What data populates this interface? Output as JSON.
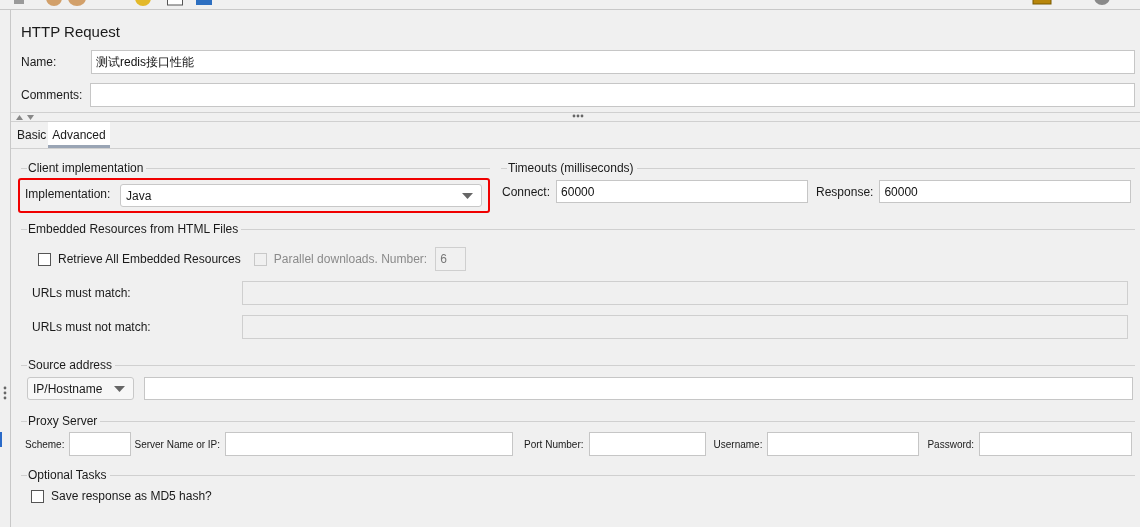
{
  "title": "HTTP Request",
  "name": {
    "label": "Name:",
    "value": "测试redis接口性能"
  },
  "comments": {
    "label": "Comments:"
  },
  "tabs": [
    {
      "label": "Basic",
      "selected": false
    },
    {
      "label": "Advanced",
      "selected": true
    }
  ],
  "client_implementation": {
    "title": "Client implementation",
    "label": "Implementation:",
    "value": "Java",
    "highlighted": true
  },
  "timeouts": {
    "title": "Timeouts (milliseconds)",
    "fields": [
      {
        "label": "Connect:",
        "value": "60000"
      },
      {
        "label": "Response:",
        "value": "60000"
      }
    ]
  },
  "embedded_resources": {
    "title": "Embedded Resources from HTML Files",
    "retrieve_all": {
      "label": "Retrieve All Embedded Resources",
      "checked": false
    },
    "parallel": {
      "label": "Parallel downloads. Number:",
      "checked": false,
      "disabled": true,
      "value": "6"
    },
    "url_filters": [
      {
        "label": "URLs must match:",
        "disabled": true
      },
      {
        "label": "URLs must not match:",
        "disabled": true
      }
    ]
  },
  "source_address": {
    "title": "Source address",
    "type": "IP/Hostname"
  },
  "proxy_server": {
    "title": "Proxy Server",
    "fields": [
      {
        "label": "Scheme:"
      },
      {
        "label": "Server Name or IP:"
      },
      {
        "label": "Port Number:"
      },
      {
        "label": "Username:"
      },
      {
        "label": "Password:"
      }
    ]
  },
  "optional_tasks": {
    "title": "Optional Tasks",
    "options": [
      {
        "label": "Save response as MD5 hash?",
        "checked": false
      }
    ]
  }
}
